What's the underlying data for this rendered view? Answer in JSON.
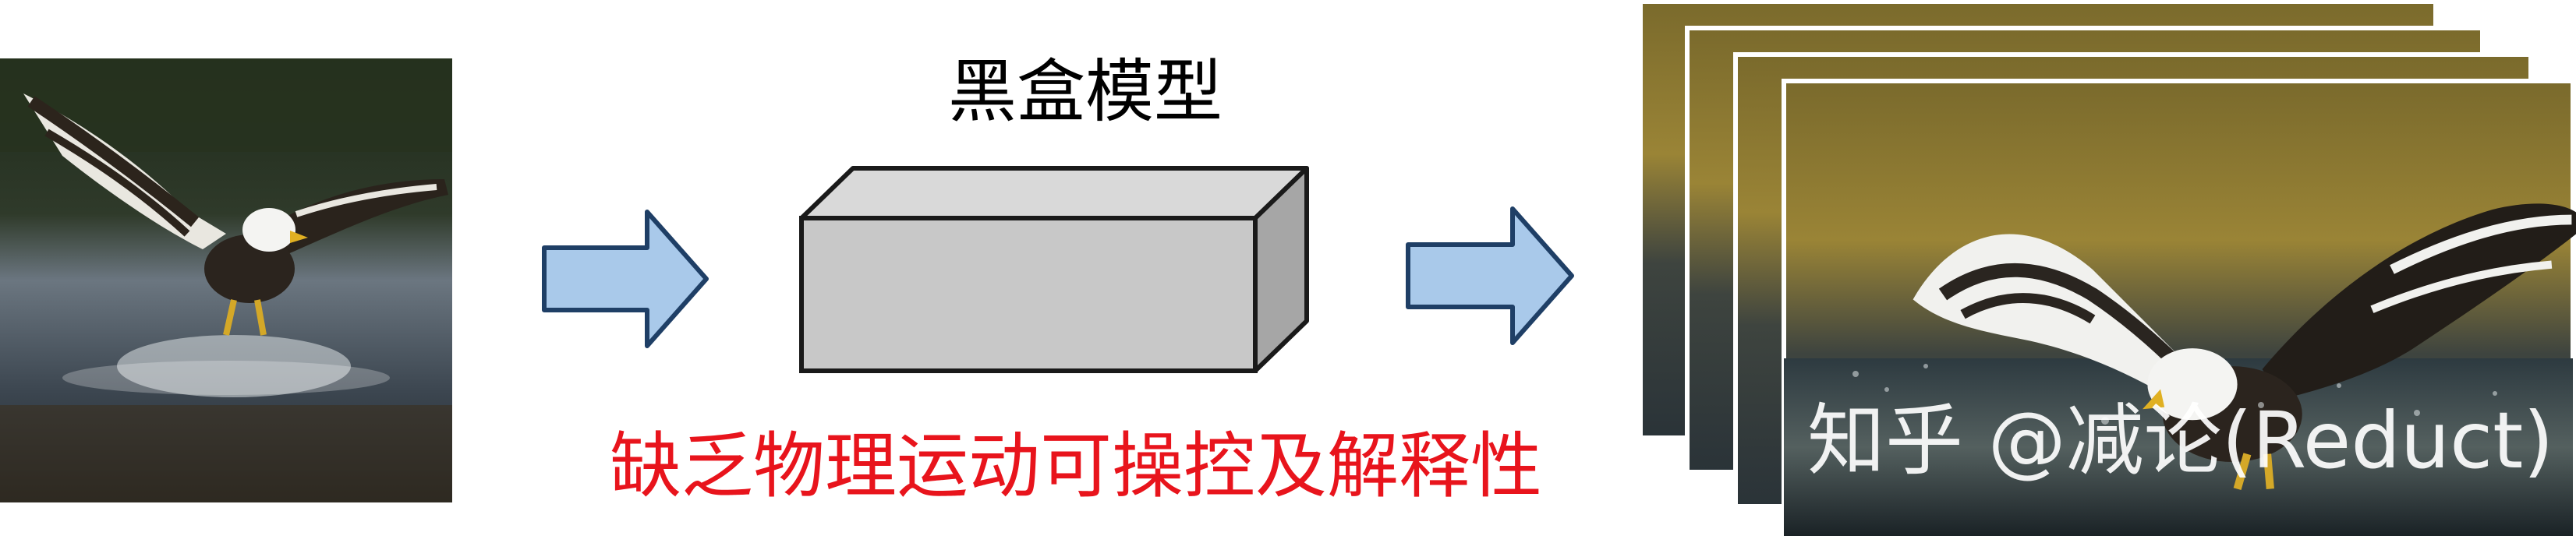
{
  "box_title": "黑盒模型",
  "caption": "缺乏物理运动可操控及解释性",
  "watermark": "知乎 @减论(Reduct)",
  "colors": {
    "arrow_fill": "#a9c9ea",
    "arrow_stroke": "#1f3f66",
    "box_front": "#c8c8c8",
    "box_top": "#d9d9d9",
    "box_side": "#a6a6a6",
    "caption": "#e8141c"
  },
  "images": {
    "input": "eagle-photo-input",
    "outputs": [
      "eagle-frame-1",
      "eagle-frame-2",
      "eagle-frame-3",
      "eagle-frame-4"
    ]
  }
}
